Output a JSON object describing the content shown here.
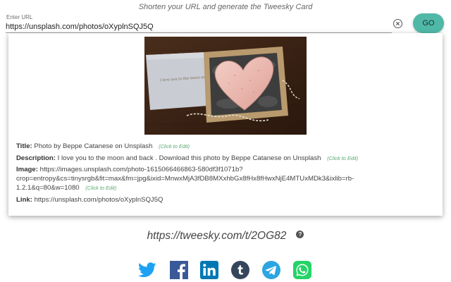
{
  "header": {
    "tagline": "Shorten your URL and generate the Tweesky Card"
  },
  "url_form": {
    "label": "Enter URL",
    "value": "https://unsplash.com/photos/oXyplnSQJ5Q",
    "go_label": "GO",
    "clear_icon": "clear-circle-icon"
  },
  "card": {
    "image_alt": "Heart-shaped ceramic dish in a gift box beside a card",
    "title_label": "Title:",
    "title_value": "Photo by Beppe Catanese on Unsplash",
    "description_label": "Description:",
    "description_value": "I love you to the moon and back . Download this photo by Beppe Catanese on Unsplash",
    "image_label": "Image:",
    "image_value_line1": "https://images.unsplash.com/photo-1615066466863-580df3f1071b?",
    "image_value_line2": "crop=entropy&cs=tinysrgb&fit=max&fm=jpg&ixid=MnwxMjA3fDB8MXxhbGx8fHx8fHwxNjE4MTUxMDk3&ixlib=rb-",
    "image_value_line3": "1.2.1&q=80&w=1080",
    "link_label": "Link:",
    "link_value": "https://unsplash.com/photos/oXyplnSQJ5Q",
    "edit_hint": "(Click to Edit)"
  },
  "result": {
    "short_url": "https://tweesky.com/t/2OG82",
    "help_icon": "?"
  },
  "share": {
    "items": [
      {
        "name": "twitter",
        "icon": "twitter-icon",
        "color": "#1da1f2"
      },
      {
        "name": "facebook",
        "icon": "facebook-icon",
        "color": "#3b5998"
      },
      {
        "name": "linkedin",
        "icon": "linkedin-icon",
        "color": "#0077b5"
      },
      {
        "name": "tumblr",
        "icon": "tumblr-icon",
        "color": "#35465c"
      },
      {
        "name": "telegram",
        "icon": "telegram-icon",
        "color": "#2ca5e0"
      },
      {
        "name": "whatsapp",
        "icon": "whatsapp-icon",
        "color": "#25d366"
      }
    ]
  },
  "colors": {
    "accent": "#4fb8a7",
    "edit_hint": "#5aa86e"
  }
}
